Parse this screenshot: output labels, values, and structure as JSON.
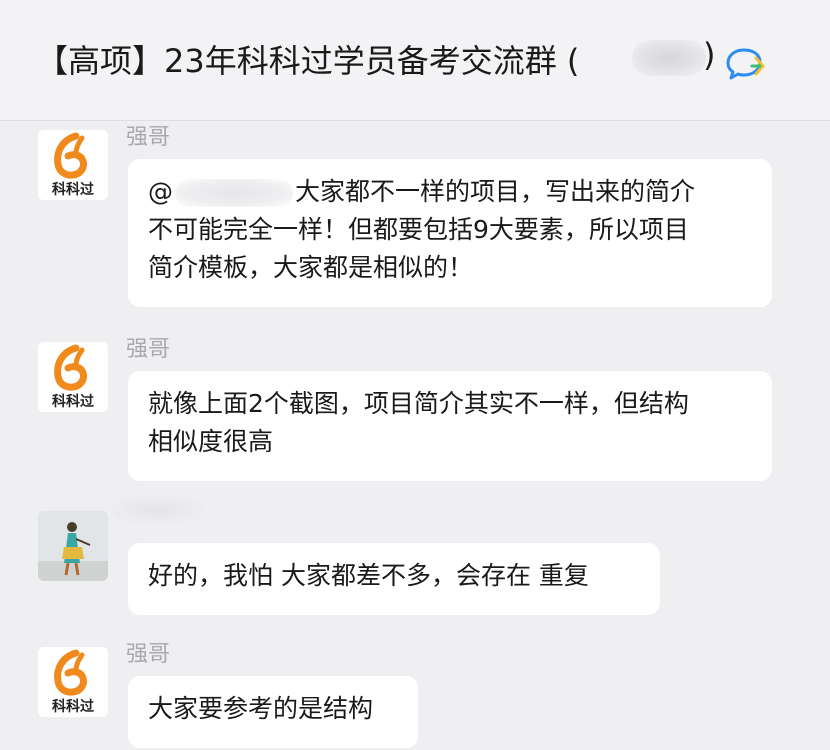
{
  "header": {
    "title": "【高项】23年科科过学员备考交流群 (",
    "close_paren": ")"
  },
  "messages": [
    {
      "sender": "强哥",
      "mention_prefix": "@",
      "lines": [
        "大家都不一样的项目，写出来的简介",
        "不可能完全一样！但都要包括9大要素，所以项目",
        "简介模板，大家都是相似的！"
      ]
    },
    {
      "sender": "强哥",
      "lines": [
        "就像上面2个截图，项目简介其实不一样，但结构",
        "相似度很高"
      ]
    },
    {
      "sender": "",
      "lines": [
        "好的，我怕 大家都差不多，会存在 重复"
      ]
    },
    {
      "sender": "强哥",
      "lines": [
        "大家要参考的是结构"
      ]
    }
  ],
  "logo": {
    "brand_text": "科科过",
    "accent_color": "#f08a1c"
  }
}
